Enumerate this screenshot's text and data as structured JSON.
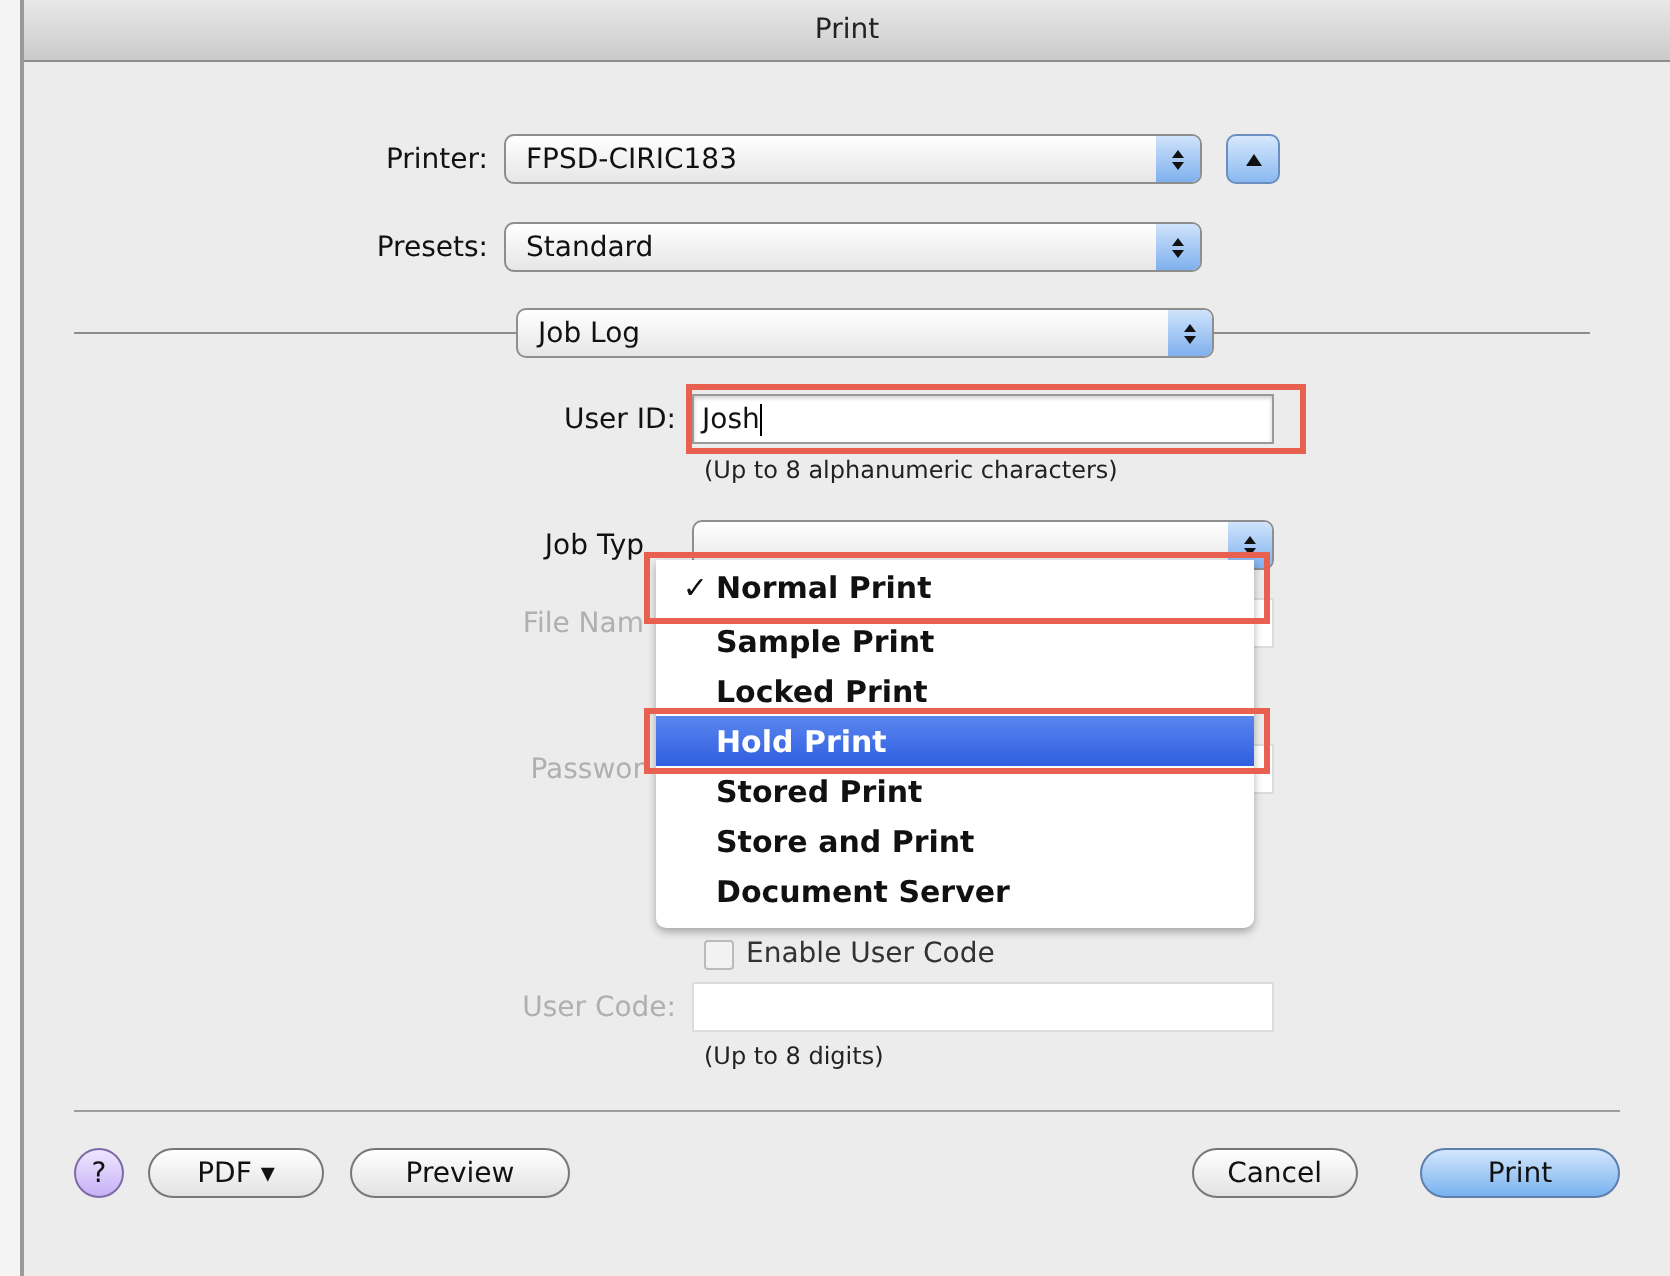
{
  "window": {
    "title": "Print"
  },
  "printer": {
    "label": "Printer:",
    "value": "FPSD-CIRIC183"
  },
  "presets": {
    "label": "Presets:",
    "value": "Standard"
  },
  "section": {
    "value": "Job Log"
  },
  "user_id": {
    "label": "User ID:",
    "value": "Josh",
    "hint": "(Up to 8 alphanumeric characters)",
    "highlighted": true
  },
  "job_type": {
    "label": "Job Typ"
  },
  "file_name": {
    "label": "File Nam",
    "disabled": true
  },
  "password": {
    "label": "Passwor",
    "disabled": true
  },
  "enable_user_code": {
    "label": "Enable User Code",
    "checked": false,
    "disabled": true
  },
  "user_code": {
    "label": "User Code:",
    "hint": "(Up to 8 digits)",
    "disabled": true
  },
  "job_type_menu": [
    {
      "label": "Normal Print",
      "checked": true,
      "selected": false,
      "highlighted": true
    },
    {
      "label": "Sample Print",
      "checked": false,
      "selected": false,
      "highlighted": false
    },
    {
      "label": "Locked Print",
      "checked": false,
      "selected": false,
      "highlighted": false
    },
    {
      "label": "Hold Print",
      "checked": false,
      "selected": true,
      "highlighted": true
    },
    {
      "label": "Stored Print",
      "checked": false,
      "selected": false,
      "highlighted": false
    },
    {
      "label": "Store and Print",
      "checked": false,
      "selected": false,
      "highlighted": false
    },
    {
      "label": "Document Server",
      "checked": false,
      "selected": false,
      "highlighted": false
    }
  ],
  "check_mark": "✓",
  "buttons": [
    {
      "kind": "help",
      "label": "?"
    },
    {
      "kind": "menu",
      "label": "PDF ▾"
    },
    {
      "kind": "plain",
      "label": "Preview"
    },
    {
      "kind": "plain",
      "label": "Cancel"
    },
    {
      "kind": "default",
      "label": "Print"
    }
  ]
}
